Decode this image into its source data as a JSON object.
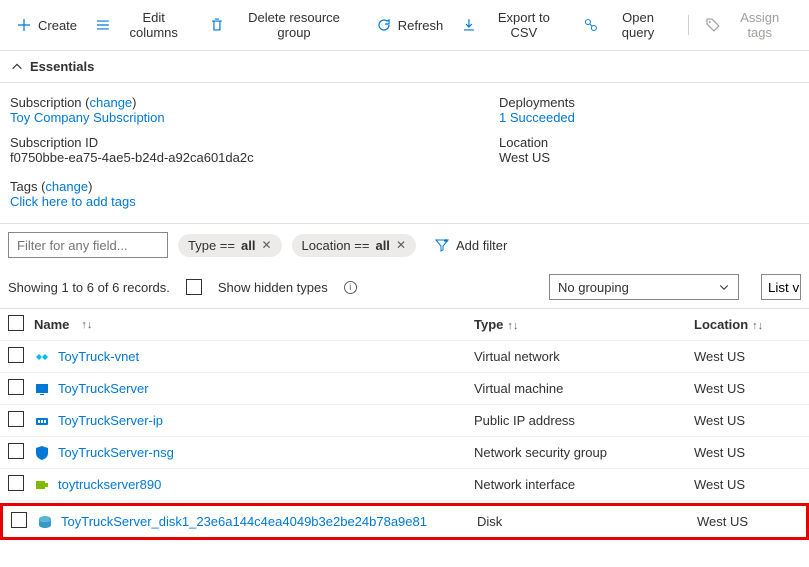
{
  "toolbar": {
    "create": "Create",
    "edit_columns": "Edit columns",
    "delete_rg": "Delete resource group",
    "refresh": "Refresh",
    "export_csv": "Export to CSV",
    "open_query": "Open query",
    "assign_tags": "Assign tags"
  },
  "essentials": {
    "header": "Essentials",
    "subscription_label": "Subscription",
    "change": "change",
    "subscription_name": "Toy Company Subscription",
    "subscription_id_label": "Subscription ID",
    "subscription_id": "f0750bbe-ea75-4ae5-b24d-a92ca601da2c",
    "tags_label": "Tags",
    "tags_placeholder": "Click here to add tags",
    "deployments_label": "Deployments",
    "deployments_value": "1 Succeeded",
    "location_label": "Location",
    "location_value": "West US"
  },
  "filters": {
    "placeholder": "Filter for any field...",
    "type_pill_prefix": "Type == ",
    "loc_pill_prefix": "Location == ",
    "pill_value": "all",
    "add_filter": "Add filter",
    "records_text": "Showing 1 to 6 of 6 records.",
    "show_hidden": "Show hidden types",
    "grouping": "No grouping",
    "listv": "List vi"
  },
  "grid": {
    "headers": {
      "name": "Name",
      "type": "Type",
      "location": "Location"
    },
    "rows": [
      {
        "name": "ToyTruck-vnet",
        "type": "Virtual network",
        "location": "West US",
        "icon": "vnet"
      },
      {
        "name": "ToyTruckServer",
        "type": "Virtual machine",
        "location": "West US",
        "icon": "vm"
      },
      {
        "name": "ToyTruckServer-ip",
        "type": "Public IP address",
        "location": "West US",
        "icon": "ip"
      },
      {
        "name": "ToyTruckServer-nsg",
        "type": "Network security group",
        "location": "West US",
        "icon": "nsg"
      },
      {
        "name": "toytruckserver890",
        "type": "Network interface",
        "location": "West US",
        "icon": "nic"
      },
      {
        "name": "ToyTruckServer_disk1_23e6a144c4ea4049b3e2be24b78a9e81",
        "type": "Disk",
        "location": "West US",
        "icon": "disk",
        "highlight": true
      }
    ]
  }
}
